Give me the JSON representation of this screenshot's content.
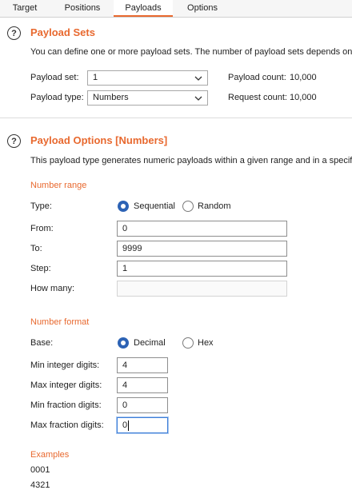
{
  "tabs": [
    {
      "label": "Target",
      "active": false
    },
    {
      "label": "Positions",
      "active": false
    },
    {
      "label": "Payloads",
      "active": true
    },
    {
      "label": "Options",
      "active": false
    }
  ],
  "payload_sets": {
    "title": "Payload Sets",
    "description": "You can define one or more payload sets. The number of payload sets depends on the",
    "payload_set_label": "Payload set:",
    "payload_set_value": "1",
    "payload_type_label": "Payload type:",
    "payload_type_value": "Numbers",
    "payload_count_label": "Payload count:",
    "payload_count_value": "10,000",
    "request_count_label": "Request count:",
    "request_count_value": "10,000"
  },
  "payload_options": {
    "title": "Payload Options [Numbers]",
    "description": "This payload type generates numeric payloads within a given range and in a specified",
    "number_range": {
      "heading": "Number range",
      "type_label": "Type:",
      "type_options": [
        {
          "label": "Sequential",
          "selected": true
        },
        {
          "label": "Random",
          "selected": false
        }
      ],
      "from_label": "From:",
      "from_value": "0",
      "to_label": "To:",
      "to_value": "9999",
      "step_label": "Step:",
      "step_value": "1",
      "how_many_label": "How many:",
      "how_many_value": ""
    },
    "number_format": {
      "heading": "Number format",
      "base_label": "Base:",
      "base_options": [
        {
          "label": "Decimal",
          "selected": true
        },
        {
          "label": "Hex",
          "selected": false
        }
      ],
      "min_integer_label": "Min integer digits:",
      "min_integer_value": "4",
      "max_integer_label": "Max integer digits:",
      "max_integer_value": "4",
      "min_fraction_label": "Min fraction digits:",
      "min_fraction_value": "0",
      "max_fraction_label": "Max fraction digits:",
      "max_fraction_value": "0"
    },
    "examples": {
      "heading": "Examples",
      "values": [
        "0001",
        "4321"
      ]
    }
  },
  "colors": {
    "accent": "#e8692f",
    "radio_selected": "#2d63b5",
    "focus_border": "#3d7ed8"
  },
  "icons": {
    "help": "help-circle-icon",
    "dropdown": "chevron-down-icon"
  }
}
